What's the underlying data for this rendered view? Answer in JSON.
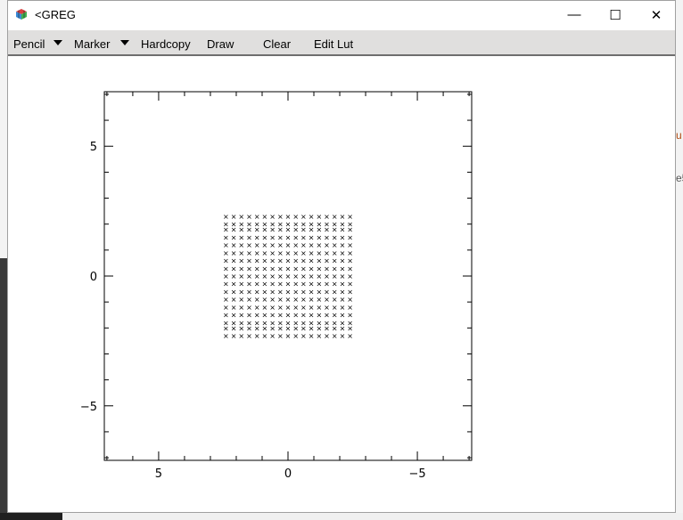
{
  "window": {
    "title": "<GREG",
    "buttons": {
      "minimize": "—",
      "maximize": "☐",
      "close": "✕"
    }
  },
  "menubar": {
    "items": [
      {
        "label": "Pencil",
        "has_dropdown": true
      },
      {
        "label": "Marker",
        "has_dropdown": true
      },
      {
        "label": "Hardcopy",
        "has_dropdown": false
      },
      {
        "label": "Draw",
        "has_dropdown": false
      },
      {
        "label": "Clear",
        "has_dropdown": false
      },
      {
        "label": "Edit Lut",
        "has_dropdown": false
      }
    ]
  },
  "background": {
    "right_fragment_1": "u",
    "right_fragment_2": "e5"
  },
  "chart_data": {
    "type": "scatter",
    "marker": "×",
    "x_axis": {
      "range": [
        7.1,
        -7.1
      ],
      "ticks": [
        5,
        0,
        -5
      ],
      "tick_labels": [
        "5",
        "0",
        "−5"
      ],
      "minor_step": 1
    },
    "y_axis": {
      "range": [
        -7.1,
        7.1
      ],
      "ticks": [
        5,
        0,
        -5
      ],
      "tick_labels": [
        "5",
        "0",
        "−5"
      ],
      "minor_step": 1
    },
    "points": {
      "x_values": [
        -2.4,
        -2.1,
        -1.8,
        -1.5,
        -1.2,
        -0.9,
        -0.6,
        -0.3,
        0.0,
        0.3,
        0.6,
        0.9,
        1.2,
        1.5,
        1.8,
        2.1,
        2.4
      ],
      "y_values": [
        2.3,
        2.0,
        1.8,
        1.5,
        1.2,
        0.9,
        0.6,
        0.3,
        0.0,
        -0.3,
        -0.6,
        -0.9,
        -1.2,
        -1.5,
        -1.8,
        -2.0,
        -2.3
      ],
      "description": "regular grid, every x paired with every y"
    }
  }
}
